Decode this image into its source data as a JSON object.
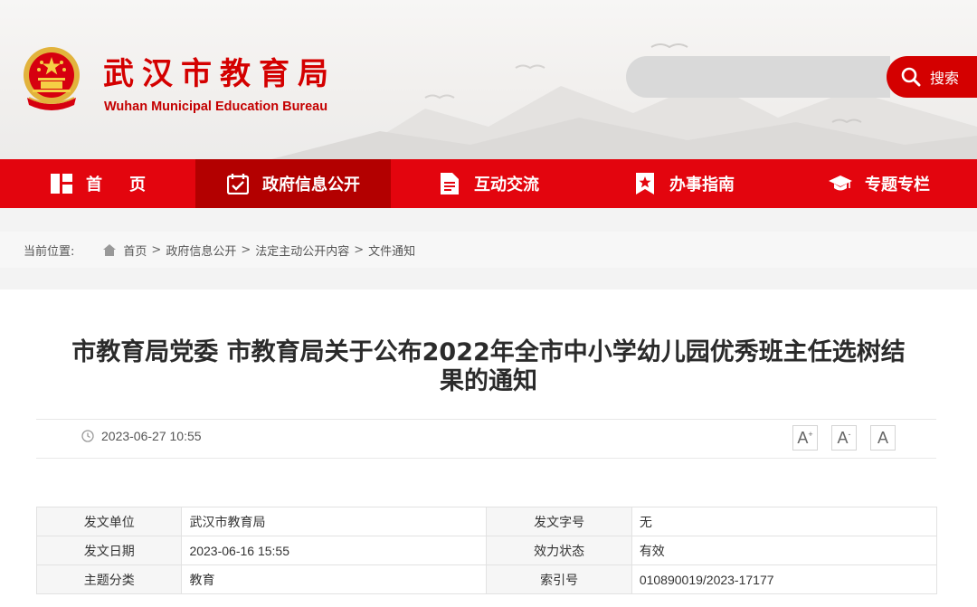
{
  "header": {
    "brand_cn": "武汉市教育局",
    "brand_en": "Wuhan Municipal Education Bureau",
    "emblem_icon": "national-emblem-icon"
  },
  "search": {
    "placeholder": "",
    "button_label": "搜索",
    "icon": "search-icon"
  },
  "nav": {
    "items": [
      {
        "label": "首页",
        "icon": "grid-icon"
      },
      {
        "label": "政府信息公开",
        "icon": "calendar-check-icon"
      },
      {
        "label": "互动交流",
        "icon": "document-icon"
      },
      {
        "label": "办事指南",
        "icon": "star-bookmark-icon"
      },
      {
        "label": "专题专栏",
        "icon": "graduation-cap-icon"
      }
    ],
    "active_index": 1
  },
  "breadcrumb": {
    "prefix": "当前位置:",
    "items": [
      "首页",
      "政府信息公开",
      "法定主动公开内容",
      "文件通知"
    ],
    "separator": ">"
  },
  "article": {
    "title_line1": "市教育局党委 市教育局关于公布2022年全市中小学幼儿园优秀班主任选树结",
    "title_line2": "果的通知",
    "publish_time": "2023-06-27 10:55",
    "font_buttons": [
      "A",
      "A",
      "A"
    ]
  },
  "info_table": {
    "rows": [
      {
        "k1": "发文单位",
        "v1": "武汉市教育局",
        "k2": "发文字号",
        "v2": "无"
      },
      {
        "k1": "发文日期",
        "v1": "2023-06-16 15:55",
        "k2": "效力状态",
        "v2": "有效"
      },
      {
        "k1": "主题分类",
        "v1": "教育",
        "k2": "索引号",
        "v2": "010890019/2023-17177"
      }
    ]
  },
  "colors": {
    "brand_red": "#d40000",
    "nav_red": "#e3050e",
    "nav_active": "#b30000"
  }
}
